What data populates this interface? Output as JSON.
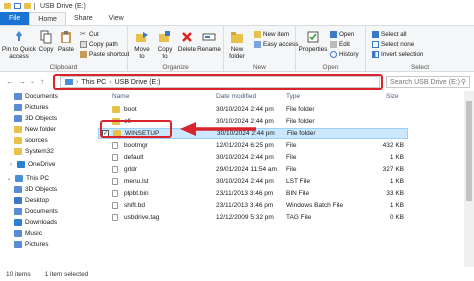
{
  "title": "USB Drive (E:)",
  "tabs": [
    "File",
    "Home",
    "Share",
    "View"
  ],
  "ribbon": {
    "clipboard": {
      "label": "Clipboard",
      "pin": "Pin to Quick access",
      "copy": "Copy",
      "paste": "Paste",
      "cut": "Cut",
      "copy_path": "Copy path",
      "paste_shortcut": "Paste shortcut"
    },
    "organize": {
      "label": "Organize",
      "move_to": "Move to",
      "copy_to": "Copy to",
      "delete": "Delete",
      "rename": "Rename"
    },
    "new": {
      "label": "New",
      "new_folder": "New folder",
      "new_item": "New item",
      "easy_access": "Easy access"
    },
    "open": {
      "label": "Open",
      "properties": "Properties",
      "open": "Open",
      "edit": "Edit",
      "history": "History"
    },
    "select": {
      "label": "Select",
      "select_all": "Select all",
      "select_none": "Select none",
      "invert": "Invert selection"
    }
  },
  "address": {
    "crumbs": [
      "This PC",
      "USB Drive (E:)"
    ],
    "search_placeholder": "Search USB Drive (E:)"
  },
  "navpane": [
    {
      "label": "Documents",
      "color": "#5b8bd6"
    },
    {
      "label": "Pictures",
      "color": "#5b8bd6"
    },
    {
      "label": "3D Objects",
      "color": "#5b8bd6"
    },
    {
      "label": "New folder",
      "color": "#e8c14a"
    },
    {
      "label": "sources",
      "color": "#e8c14a"
    },
    {
      "label": "System32",
      "color": "#e8c14a"
    },
    {
      "label": "OneDrive",
      "color": "#2d7fd1"
    },
    {
      "label": "This PC",
      "color": "#4a90d9"
    },
    {
      "label": "3D Objects",
      "color": "#5b8bd6"
    },
    {
      "label": "Desktop",
      "color": "#3a78c8"
    },
    {
      "label": "Documents",
      "color": "#5b8bd6"
    },
    {
      "label": "Downloads",
      "color": "#2d7fd1"
    },
    {
      "label": "Music",
      "color": "#5b8bd6"
    },
    {
      "label": "Pictures",
      "color": "#5b8bd6"
    }
  ],
  "columns": {
    "name": "Name",
    "date": "Date modified",
    "type": "Type",
    "size": "Size"
  },
  "files": [
    {
      "name": "boot",
      "date": "30/10/2024 2:44 pm",
      "type": "File folder",
      "size": "",
      "kind": "folder"
    },
    {
      "name": "efi",
      "date": "30/10/2024 2:44 pm",
      "type": "File folder",
      "size": "",
      "kind": "folder"
    },
    {
      "name": "WINSETUP",
      "date": "30/10/2024 2:44 pm",
      "type": "File folder",
      "size": "",
      "kind": "folder",
      "selected": true
    },
    {
      "name": "bootmgr",
      "date": "12/01/2024 6:25 pm",
      "type": "File",
      "size": "432 KB",
      "kind": "file"
    },
    {
      "name": "default",
      "date": "30/10/2024 2:44 pm",
      "type": "File",
      "size": "1 KB",
      "kind": "file"
    },
    {
      "name": "grldr",
      "date": "29/01/2024 11:54 am",
      "type": "File",
      "size": "327 KB",
      "kind": "file"
    },
    {
      "name": "menu.lst",
      "date": "30/10/2024 2:44 pm",
      "type": "LST File",
      "size": "1 KB",
      "kind": "file"
    },
    {
      "name": "plpbt.bin",
      "date": "23/11/2013 3:46 pm",
      "type": "BIN File",
      "size": "33 KB",
      "kind": "file"
    },
    {
      "name": "shift.bd",
      "date": "23/11/2013 3:46 pm",
      "type": "Windows Batch File",
      "size": "1 KB",
      "kind": "file"
    },
    {
      "name": "usbdrive.tag",
      "date": "12/12/2009 5:32 pm",
      "type": "TAG File",
      "size": "0 KB",
      "kind": "file"
    }
  ],
  "status": {
    "count": "10 items",
    "selected": "1 item selected"
  },
  "colors": {
    "accent": "#1a73d0",
    "highlight": "#d9242b",
    "selection": "#cce8ff",
    "folder": "#e8c14a"
  }
}
